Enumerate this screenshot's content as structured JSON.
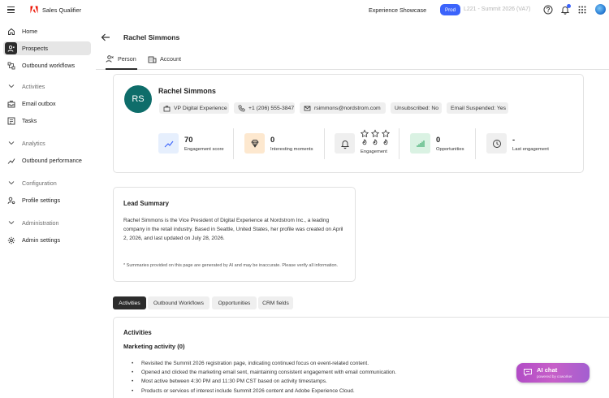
{
  "app": {
    "name": "Sales Qualifier",
    "logo_icon": "adobe-logo-icon",
    "accent_color": "#3b63fb"
  },
  "topbar": {
    "workspace": "Experience Showcase",
    "env_badge": "Prod",
    "sandbox": "L221 - Summit 2026 (VA7)",
    "icons": [
      "help-icon",
      "bell-icon",
      "apps-grid-icon",
      "user-avatar"
    ]
  },
  "sidebar": {
    "home": "Home",
    "prospects": "Prospects",
    "outbound_workflows": "Outbound workflows",
    "activities_section": "Activities",
    "email_outbox": "Email outbox",
    "tasks": "Tasks",
    "analytics_section": "Analytics",
    "outbound_performance": "Outbound performance",
    "configuration_section": "Configuration",
    "profile_settings": "Profile settings",
    "administration_section": "Administration",
    "admin_settings": "Admin settings"
  },
  "header": {
    "title": "Rachel Simmons",
    "tabs": {
      "person": "Person",
      "account": "Account"
    }
  },
  "profile": {
    "initials": "RS",
    "avatar_color": "#0e6d6a",
    "name": "Rachel Simmons",
    "chips": {
      "title": "VP Digital Experience",
      "phone": "+1 (206) 555-3847",
      "email": "rsimmons@nordstrom.com",
      "unsubscribed": "Unsubscribed: No",
      "email_suspended": "Email Suspended: Yes"
    },
    "metrics": {
      "engagement_score_value": "70",
      "engagement_score_label": "Engagement score",
      "interesting_moments_value": "0",
      "interesting_moments_label": "Interesting moments",
      "engagement_label": "Engagement",
      "opportunities_value": "0",
      "opportunities_label": "Opportunities",
      "last_engagement_value": "-",
      "last_engagement_label": "Last engagement"
    }
  },
  "lead_summary": {
    "title": "Lead Summary",
    "text": "Rachel Simmons is the Vice President of Digital Experience at Nordstrom Inc., a leading company in the retail industry. Based in Seattle, United States, her profile was created on April 2, 2026, and last updated on July 28, 2026.",
    "note": "* Summaries provided on this page are generated by AI and may be inaccurate. Please verify all information."
  },
  "detail_tabs": {
    "activities": "Activities",
    "outbound_workflows": "Outbound Workflows",
    "opportunities": "Opportunities",
    "crm_fields": "CRM fields"
  },
  "activities": {
    "title": "Activities",
    "marketing_heading": "Marketing activity (0)",
    "items": [
      "Revisited the Summit 2026 registration page, indicating continued focus on event-related content.",
      "Opened and clicked the marketing email sent, maintaining consistent engagement with email communication.",
      "Most active between 4:30 PM and 11:30 PM CST based on activity timestamps.",
      "Products or services of interest include Summit 2026 content and Adobe Experience Cloud."
    ]
  },
  "ai_chat": {
    "label": "AI chat",
    "sub": "powered by coworker"
  }
}
